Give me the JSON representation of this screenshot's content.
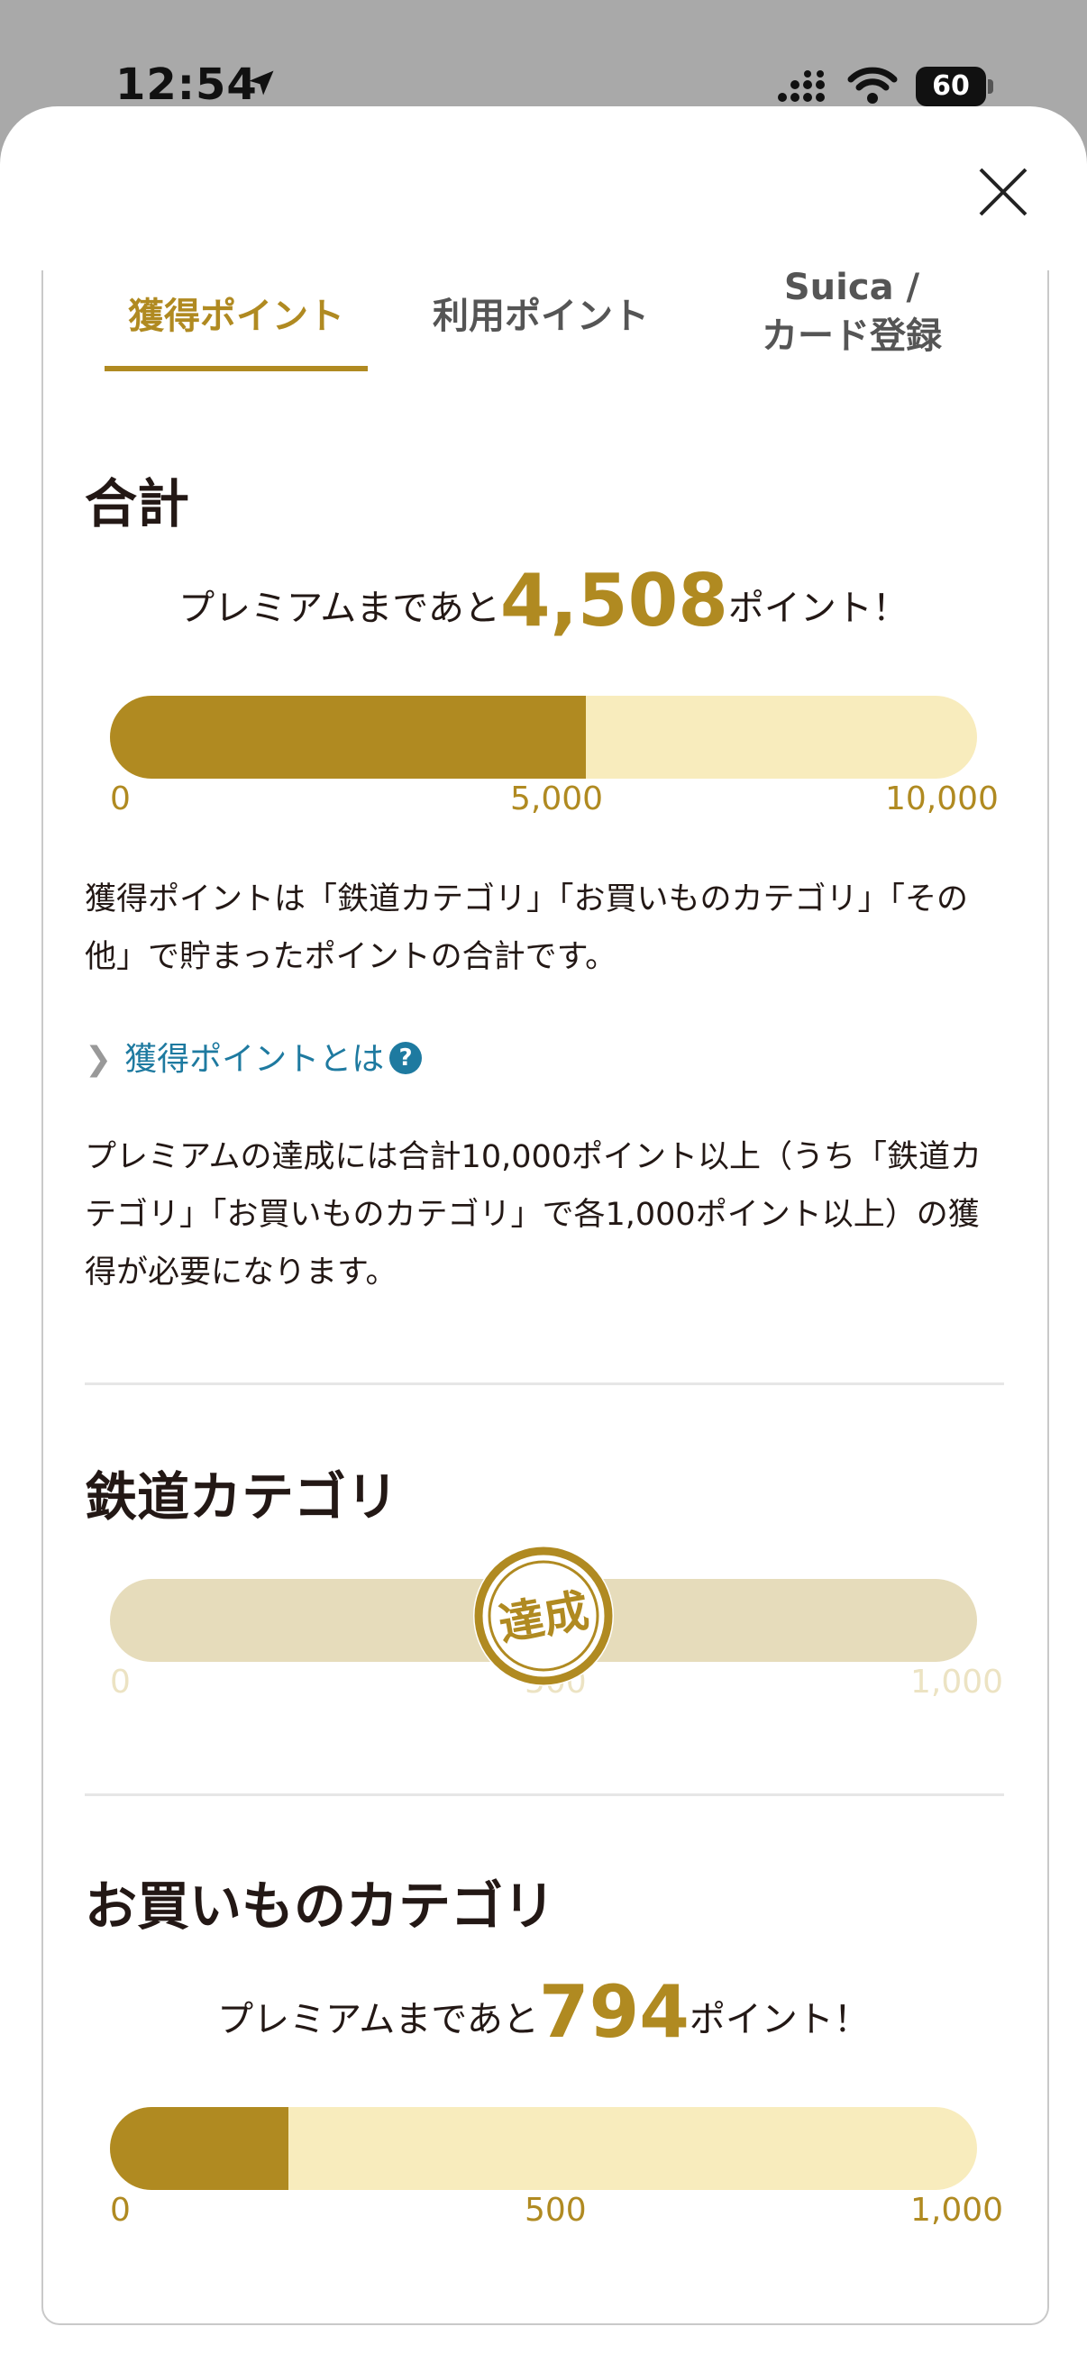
{
  "status_bar": {
    "time": "12:54",
    "battery": "60"
  },
  "tabs": [
    {
      "label": "獲得ポイント",
      "active": true
    },
    {
      "label": "利用ポイント",
      "active": false
    },
    {
      "label_line1": "Suica /",
      "label_line2": "カード登録",
      "active": false
    }
  ],
  "total": {
    "title": "合計",
    "remain_prefix": "プレミアムまであと",
    "remain_value": "4,508",
    "remain_suffix": "ポイント！",
    "progress_fraction": 0.549,
    "ticks": [
      "0",
      "5,000",
      "10,000"
    ],
    "description": "獲得ポイントは「鉄道カテゴリ」「お買いものカテゴリ」「その他」で貯まったポイントの合計です。",
    "link_label": "獲得ポイントとは",
    "requirement": "プレミアムの達成には合計10,000ポイント以上（うち「鉄道カテゴリ」「お買いものカテゴリ」で各1,000ポイント以上）の獲得が必要になります。"
  },
  "railway": {
    "title": "鉄道カテゴリ",
    "stamp_label": "達成",
    "ticks": [
      "0",
      "500",
      "1,000"
    ]
  },
  "shopping": {
    "title": "お買いものカテゴリ",
    "remain_prefix": "プレミアムまであと",
    "remain_value": "794",
    "remain_suffix": "ポイント！",
    "progress_fraction": 0.206,
    "ticks": [
      "0",
      "500",
      "1,000"
    ]
  },
  "colors": {
    "accent": "#b08a21",
    "track": "#f8ecbd",
    "done_track": "#e6dcbb",
    "link": "#1e7aa0"
  },
  "icons": [
    "location-arrow-icon",
    "signal-icon",
    "wifi-icon",
    "battery-icon",
    "close-icon",
    "chevron-right-icon",
    "question-icon",
    "achieved-stamp-icon"
  ]
}
